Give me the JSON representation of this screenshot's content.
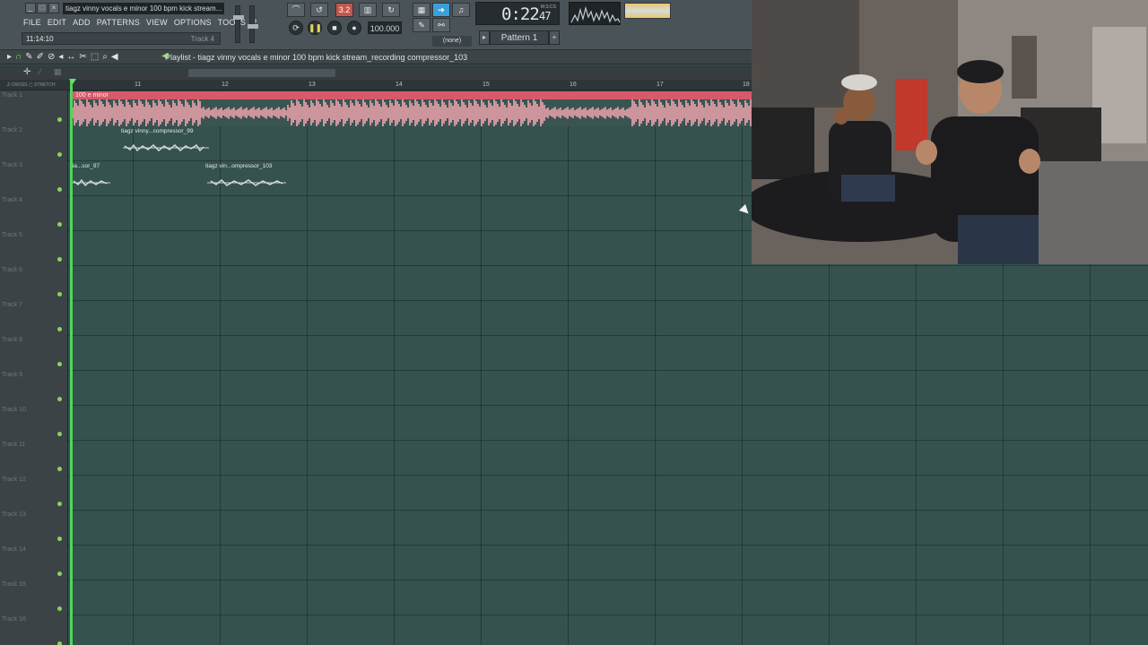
{
  "window": {
    "title": "tiagz vinny vocals e minor 100 bpm kick stream...",
    "controls": [
      "_",
      "□",
      "×"
    ]
  },
  "menu": [
    "FILE",
    "EDIT",
    "ADD",
    "PATTERNS",
    "VIEW",
    "OPTIONS",
    "TOOLS",
    "?"
  ],
  "hint_bar": {
    "value": "11:14:10",
    "track": "Track 4"
  },
  "transport": {
    "tempo": "100.000",
    "time": "0:22",
    "time_small": "47",
    "time_unit": "M:S:CS",
    "snap": "(none)",
    "pattern": "Pattern 1",
    "song_mode_label": "3.2"
  },
  "playlist": {
    "title": "Playlist - tiagz vinny vocals e minor 100 bpm kick stream_recording compressor_103",
    "zoom_chip": "Z-CROSS ▢ STRETCH",
    "ruler": [
      "11",
      "12",
      "13",
      "14",
      "15",
      "16",
      "17",
      "18"
    ],
    "tracks": [
      "Track 1",
      "Track 2",
      "Track 3",
      "Track 4",
      "Track 5",
      "Track 6",
      "Track 7",
      "Track 8",
      "Track 9",
      "Track 10",
      "Track 11",
      "Track 12",
      "Track 13",
      "Track 14",
      "Track 15",
      "Track 16"
    ],
    "clips": [
      {
        "name": "100 e minor",
        "track": 1
      },
      {
        "name": "tiagz vinny...compressor_99",
        "track": 2
      },
      {
        "name": "tia...sor_97",
        "track": 3
      },
      {
        "name": "tiagz vin...ompressor_103",
        "track": 3
      }
    ]
  },
  "colors": {
    "accent_green": "#4ed65a",
    "clip_pink": "#f2a5b0",
    "grid_bg": "#35524e"
  }
}
